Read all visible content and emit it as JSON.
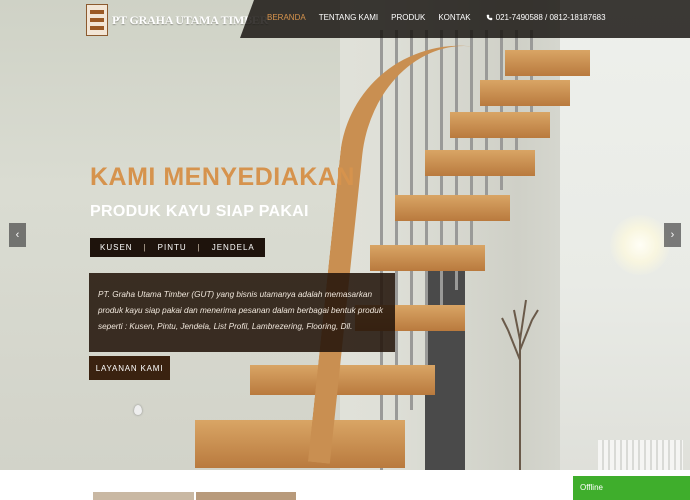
{
  "brand": {
    "name": "PT GRAHA UTAMA TIMBER"
  },
  "nav": {
    "items": [
      {
        "label": "BERANDA",
        "active": true
      },
      {
        "label": "TENTANG KAMI",
        "active": false
      },
      {
        "label": "PRODUK",
        "active": false
      },
      {
        "label": "KONTAK",
        "active": false
      }
    ],
    "phone": "021-7490588 / 0812-18187683",
    "phone_icon": "phone-icon"
  },
  "hero": {
    "headline": "KAMI MENYEDIAKAN",
    "subheadline": "PRODUK KAYU SIAP PAKAI",
    "tags": [
      "KUSEN",
      "PINTU",
      "JENDELA"
    ],
    "tag_separator": "|",
    "description": "PT. Graha Utama Timber (GUT) yang bisnis utamanya adalah memasarkan produk kayu siap pakai dan menerima pesanan dalam berbagai bentuk produk seperti : Kusen, Pintu, Jendela, List Profil, Lambrezering, Flooring, Dll.",
    "cta_label": "LAYANAN KAMI",
    "prev_arrow": "‹",
    "next_arrow": "›"
  },
  "chat": {
    "status": "Offline"
  },
  "colors": {
    "accent": "#d6934d",
    "dark_brown": "#3a2210",
    "online_green": "#3fae2c"
  }
}
